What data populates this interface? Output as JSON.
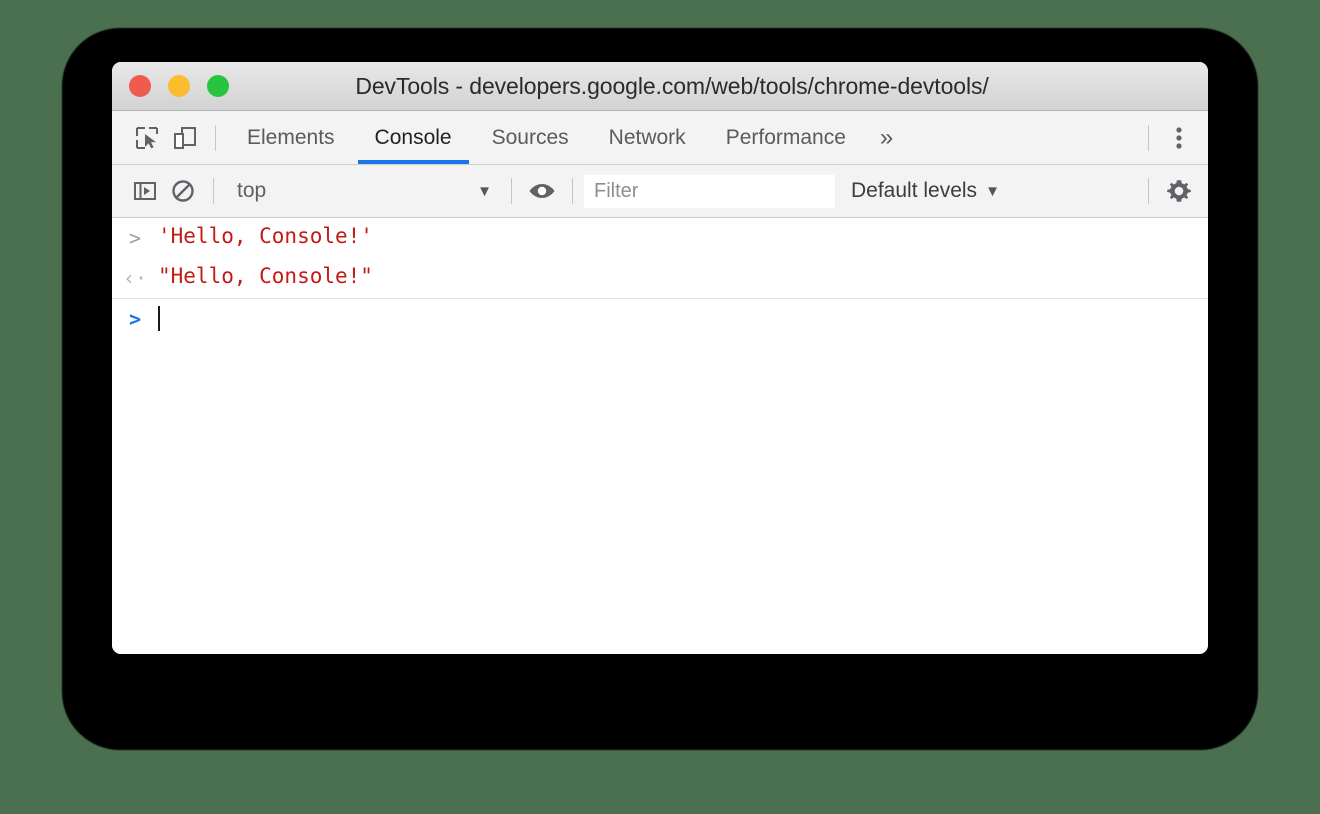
{
  "window": {
    "title": "DevTools - developers.google.com/web/tools/chrome-devtools/",
    "traffic_lights": [
      {
        "name": "close",
        "color": "#f05b50"
      },
      {
        "name": "minimize",
        "color": "#fbbc2e"
      },
      {
        "name": "maximize",
        "color": "#27c53f"
      }
    ]
  },
  "tab_bar": {
    "left_icons": [
      {
        "name": "inspect-element-icon",
        "title": "Inspect element"
      },
      {
        "name": "device-toolbar-icon",
        "title": "Toggle device toolbar"
      }
    ],
    "tabs": [
      {
        "label": "Elements",
        "active": false
      },
      {
        "label": "Console",
        "active": true
      },
      {
        "label": "Sources",
        "active": false
      },
      {
        "label": "Network",
        "active": false
      },
      {
        "label": "Performance",
        "active": false
      }
    ],
    "more_label": "»",
    "menu_icon": "more-vertical-icon",
    "active_underline_color": "#1a73e8"
  },
  "console_toolbar": {
    "sidebar_toggle_icon": "console-sidebar-toggle-icon",
    "clear_console_icon": "clear-console-icon",
    "context": {
      "value": "top",
      "caret": "▼"
    },
    "live_expression_icon": "eye-icon",
    "filter": {
      "value": "",
      "placeholder": "Filter"
    },
    "levels": {
      "label": "Default levels",
      "caret": "▼"
    },
    "settings_icon": "gear-icon"
  },
  "console": {
    "rows": [
      {
        "kind": "input",
        "arrow": ">",
        "text": "'Hello, Console!'",
        "color": "#c41a16"
      },
      {
        "kind": "result",
        "arrow": "‹·",
        "text": "\"Hello, Console!\"",
        "color": "#c41a16"
      }
    ],
    "prompt": {
      "arrow": ">",
      "value": ""
    }
  },
  "colors": {
    "desktop_background": "#4a7050",
    "window_background": "#ffffff",
    "toolbar_background": "#f3f3f3",
    "accent_blue": "#1a73e8",
    "string_red": "#c41a16"
  }
}
